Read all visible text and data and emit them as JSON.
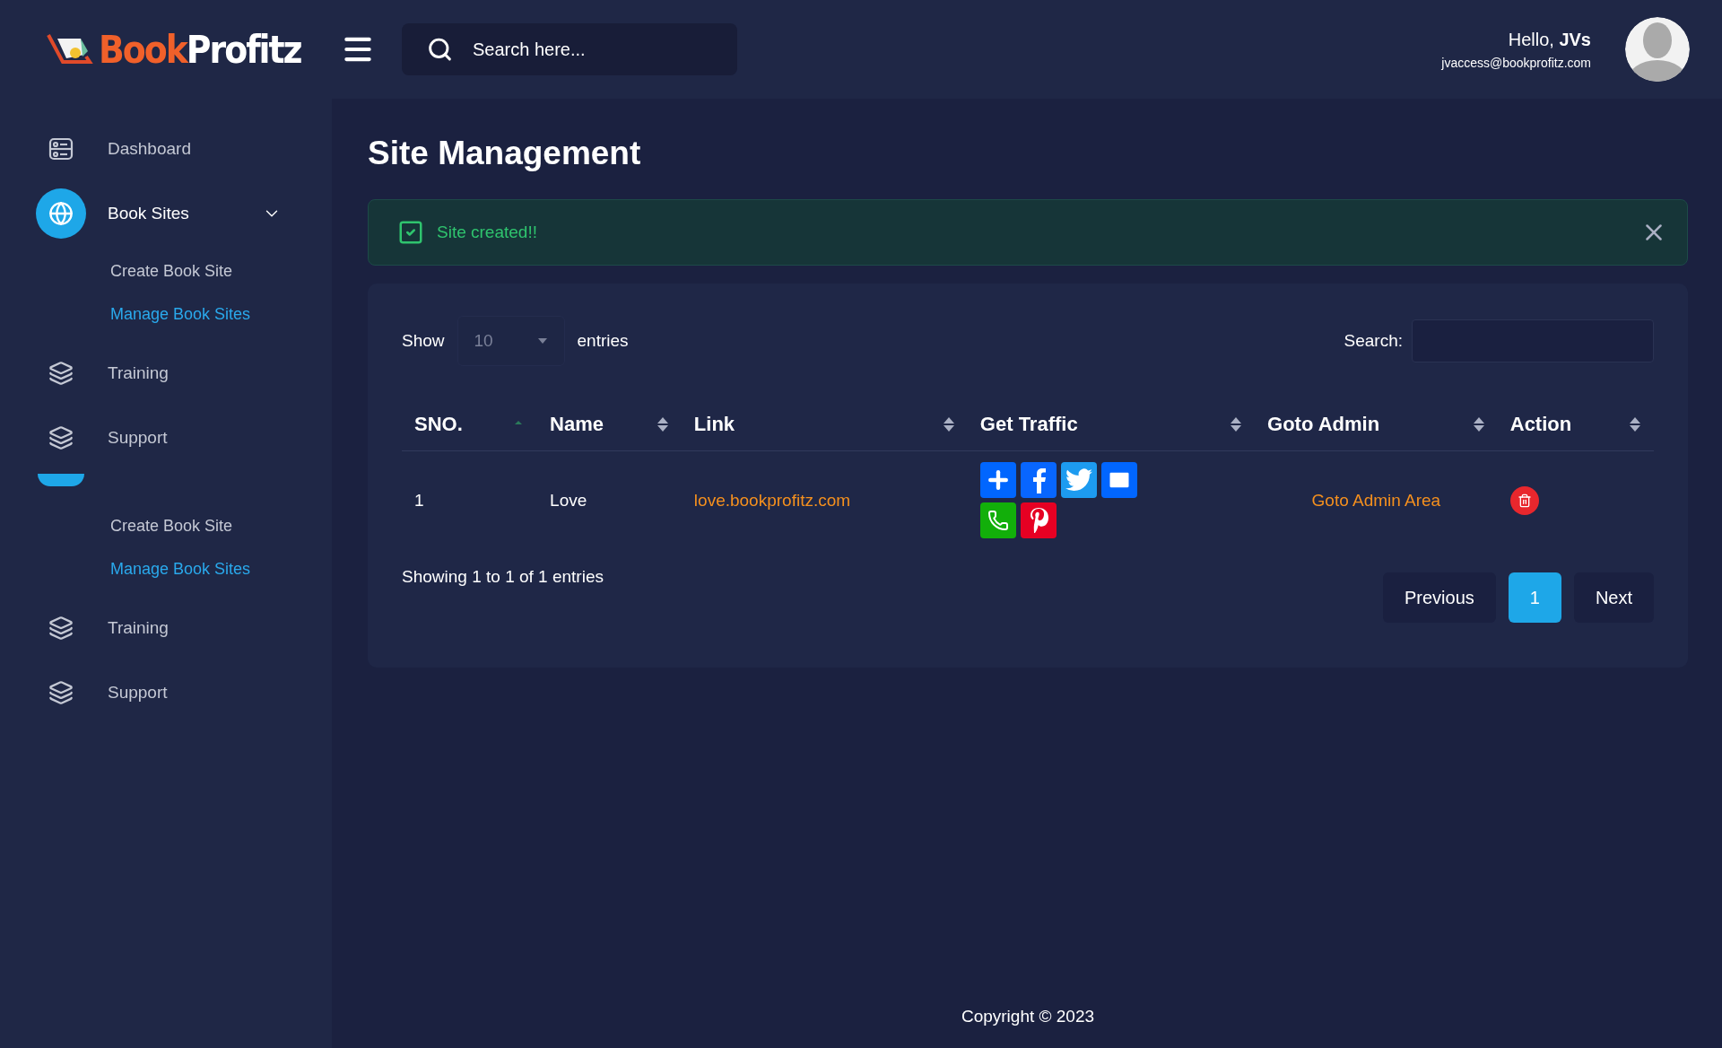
{
  "header": {
    "logo": {
      "first": "Book",
      "second": "Profitz"
    },
    "search": {
      "placeholder": "Search here..."
    },
    "user": {
      "greeting": "Hello,",
      "name": "JVs",
      "email": "jvaccess@bookprofitz.com"
    }
  },
  "sidebar": {
    "items": [
      {
        "kind": "dashboard",
        "label": "Dashboard",
        "selected": false
      },
      {
        "kind": "globe",
        "label": "Book Sites",
        "selected": true,
        "expanded": true,
        "children": [
          {
            "label": "Create Book Site",
            "selected": false
          },
          {
            "label": "Manage Book Sites",
            "selected": true
          }
        ]
      },
      {
        "kind": "layers",
        "label": "Training",
        "selected": false
      },
      {
        "kind": "layers",
        "label": "Support",
        "selected": false
      },
      {
        "kind": "clipped",
        "selected": true,
        "expanded": true,
        "children": [
          {
            "label": "Create Book Site",
            "selected": false
          },
          {
            "label": "Manage Book Sites",
            "selected": true
          }
        ]
      },
      {
        "kind": "layers",
        "label": "Training",
        "selected": false
      },
      {
        "kind": "layers",
        "label": "Support",
        "selected": false
      }
    ]
  },
  "page": {
    "title": "Site Management",
    "alert": {
      "message": "Site created!!"
    },
    "table": {
      "show_label": "Show",
      "page_size": "10",
      "entries_label": "entries",
      "search_label": "Search:",
      "columns": [
        {
          "label": "SNO.",
          "sorted": true
        },
        {
          "label": "Name",
          "sorted": false
        },
        {
          "label": "Link",
          "sorted": false
        },
        {
          "label": "Get Traffic",
          "sorted": false
        },
        {
          "label": "Goto Admin",
          "sorted": false
        },
        {
          "label": "Action",
          "sorted": false
        }
      ],
      "rows": [
        {
          "sno": "1",
          "name": "Love",
          "link": "love.bookprofitz.com",
          "admin_link": "Goto Admin Area"
        }
      ],
      "info": "Showing 1 to 1 of 1 entries",
      "pagination": [
        {
          "label": "Previous",
          "selected": false
        },
        {
          "label": "1",
          "selected": true
        },
        {
          "label": "Next",
          "selected": false
        }
      ]
    }
  },
  "footer": "Copyright © 2023"
}
